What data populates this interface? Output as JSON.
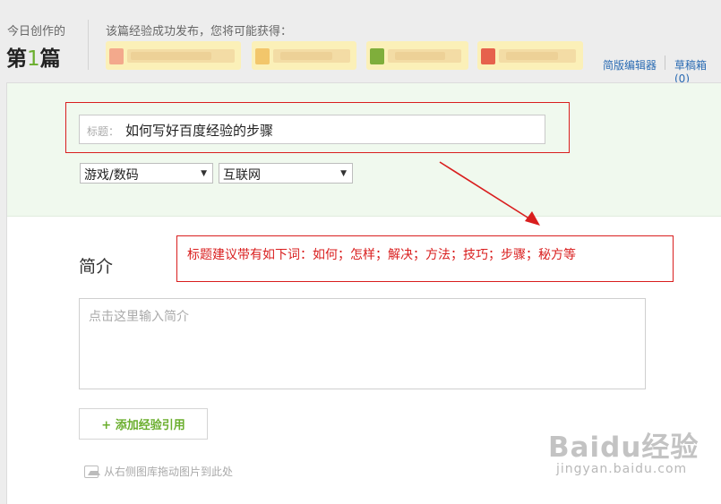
{
  "header": {
    "today_label": "今日创作的",
    "today_count_prefix": "第",
    "today_count_number": "1",
    "today_count_suffix": "篇",
    "reward_label": "该篇经验成功发布，您将可能获得：",
    "badges": [
      {
        "icon_color": "#f3a98c"
      },
      {
        "icon_color": "#f2c66b"
      },
      {
        "icon_color": "#7fae3b"
      },
      {
        "icon_color": "#e6614c"
      }
    ],
    "simple_editor_link": "简版编辑器",
    "draft_link": "草稿箱(0)"
  },
  "editor": {
    "title_prefix": "标题：",
    "title_value": "如何写好百度经验的步骤",
    "category_1": "游戏/数码",
    "category_2": "互联网",
    "intro_heading": "简介",
    "intro_placeholder": "点击这里输入简介",
    "add_reference_label": "+ 添加经验引用",
    "image_hint": "从右侧图库拖动图片到此处"
  },
  "annotation": {
    "note": "标题建议带有如下词：如何；怎样；解决；方法；技巧；步骤；秘方等",
    "color": "#d91e1e"
  },
  "watermark": {
    "logo": "Baidu经验",
    "url": "jingyan.baidu.com"
  }
}
